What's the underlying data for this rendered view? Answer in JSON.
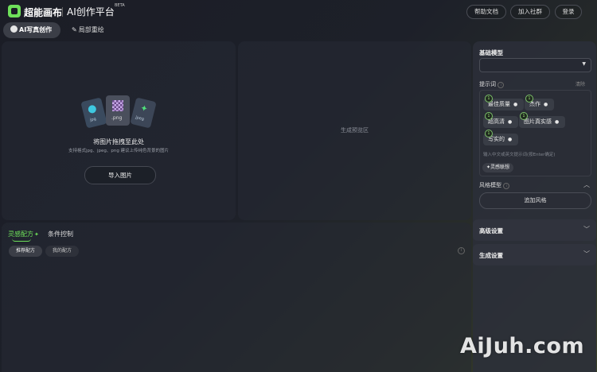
{
  "header": {
    "logo_text": "超能画布",
    "app_title": "AI创作平台",
    "beta": "BETA",
    "help_label": "帮助文档",
    "community_label": "加入社群",
    "login_label": "登录"
  },
  "tabs": [
    {
      "label": "AI写真创作",
      "active": true
    },
    {
      "label": "局部重绘",
      "active": false
    }
  ],
  "upload": {
    "ext_jpg": "jpg",
    "ext_png": ".png",
    "ext_jpeg": "jpeg",
    "title": "将图片拖拽至此处",
    "subtitle": "支持格式jpg、jpeg、png 建议上传纯色背景的图片",
    "button": "导入图片"
  },
  "preview": {
    "placeholder": "生成预览区"
  },
  "recipe": {
    "tab_inspiration": "灵感配方",
    "tab_condition": "条件控制",
    "subtab_recommended": "推荐配方",
    "subtab_mine": "我的配方"
  },
  "right": {
    "base_model_label": "基础模型",
    "prompt_label": "提示词",
    "clear_label": "清除",
    "tags": [
      {
        "num": "1",
        "text": "最佳质量"
      },
      {
        "num": "1",
        "text": "杰作"
      },
      {
        "num": "1",
        "text": "超高清"
      },
      {
        "num": "1",
        "text": "图片真实感"
      },
      {
        "num": "1",
        "text": "写实的"
      }
    ],
    "prompt_placeholder": "输入中文或英文提示词(按Enter确定)",
    "inspiration_button": "灵感联想",
    "style_model_label": "风格模型",
    "add_style_button": "追加风格",
    "advanced_label": "高级设置",
    "generate_settings_label": "生成设置"
  },
  "watermark": "AiJuh.com",
  "colors": {
    "accent": "#6ee05a",
    "panel": "#262934"
  }
}
